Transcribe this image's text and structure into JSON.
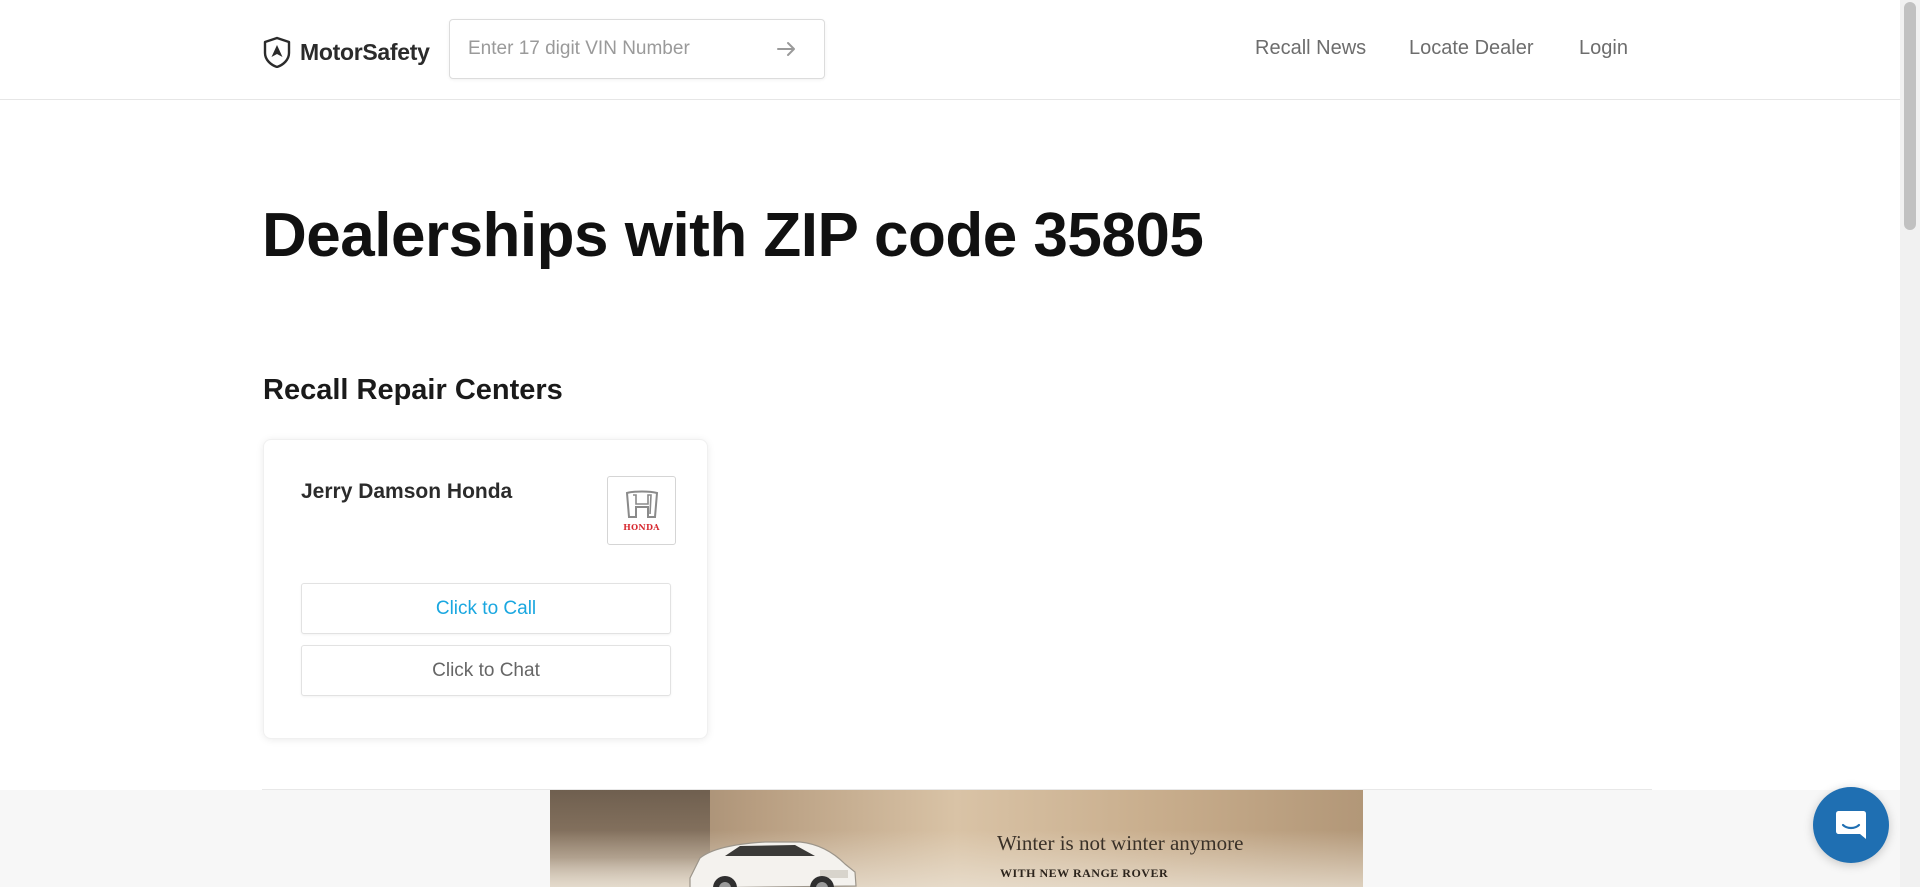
{
  "header": {
    "brand": "MotorSafety",
    "logo_icon": "shield-navigation-icon",
    "vin_placeholder": "Enter 17 digit VIN Number",
    "vin_submit_icon": "arrow-right-icon",
    "nav": {
      "recall_news": "Recall News",
      "locate_dealer": "Locate Dealer",
      "login": "Login"
    }
  },
  "main": {
    "title": "Dealerships with ZIP code 35805",
    "section_title": "Recall Repair Centers",
    "dealer": {
      "name": "Jerry Damson Honda",
      "brand_logo_text": "HONDA",
      "call_label": "Click to Call",
      "chat_label": "Click to Chat"
    }
  },
  "ad": {
    "headline": "Winter is not winter anymore",
    "subline": "WITH NEW RANGE ROVER"
  },
  "chat_launcher": {
    "icon": "chat-bubble-icon"
  },
  "colors": {
    "accent_link": "#1aa7e0",
    "chat_launcher": "#1f6fb2",
    "honda_red": "#d7282f"
  }
}
